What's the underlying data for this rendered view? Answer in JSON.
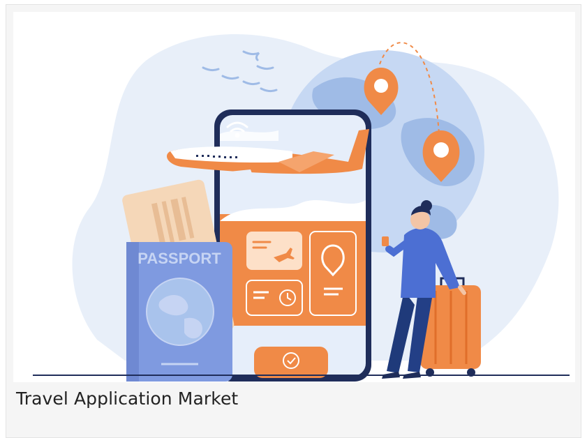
{
  "card": {
    "caption": "Travel Application Market"
  },
  "illustration": {
    "passport_label": "PASSPORT",
    "icons": [
      "wifi-icon",
      "airplane-icon",
      "location-pin-icon",
      "clock-icon",
      "check-icon",
      "globe-icon"
    ]
  },
  "colors": {
    "accent_orange": "#f08a47",
    "globe_blue": "#a9c3ec",
    "passport_blue": "#7f9ae0",
    "dark_navy": "#1f2d5a",
    "background_blob": "#e8eff9"
  }
}
